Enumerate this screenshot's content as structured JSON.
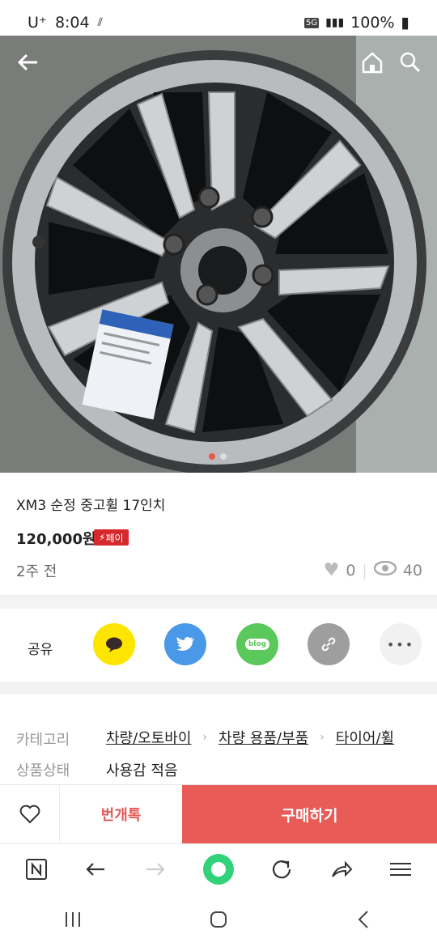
{
  "status_bar": {
    "carrier": "U⁺",
    "time": "8:04",
    "network": "5G",
    "battery": "100%"
  },
  "product": {
    "title": "XM3 순정 중고휠 17인치",
    "price": "120,000원",
    "pay_badge": "페이",
    "posted": "2주 전",
    "likes": "0",
    "views": "40"
  },
  "share": {
    "label": "공유",
    "blog_label": "blog"
  },
  "meta": {
    "category_label": "카테고리",
    "categories": [
      "차량/오토바이",
      "차량 용품/부품",
      "타이어/휠"
    ],
    "condition_label": "상품상태",
    "condition": "사용감 적음"
  },
  "actions": {
    "talk": "번개톡",
    "buy": "구매하기"
  },
  "image": {
    "slides": 2,
    "active_slide": 1
  },
  "colors": {
    "accent": "#e85b57",
    "kakao": "#fee500",
    "twitter": "#4a99e9",
    "blog": "#5ac85a",
    "link": "#9e9e9e"
  }
}
